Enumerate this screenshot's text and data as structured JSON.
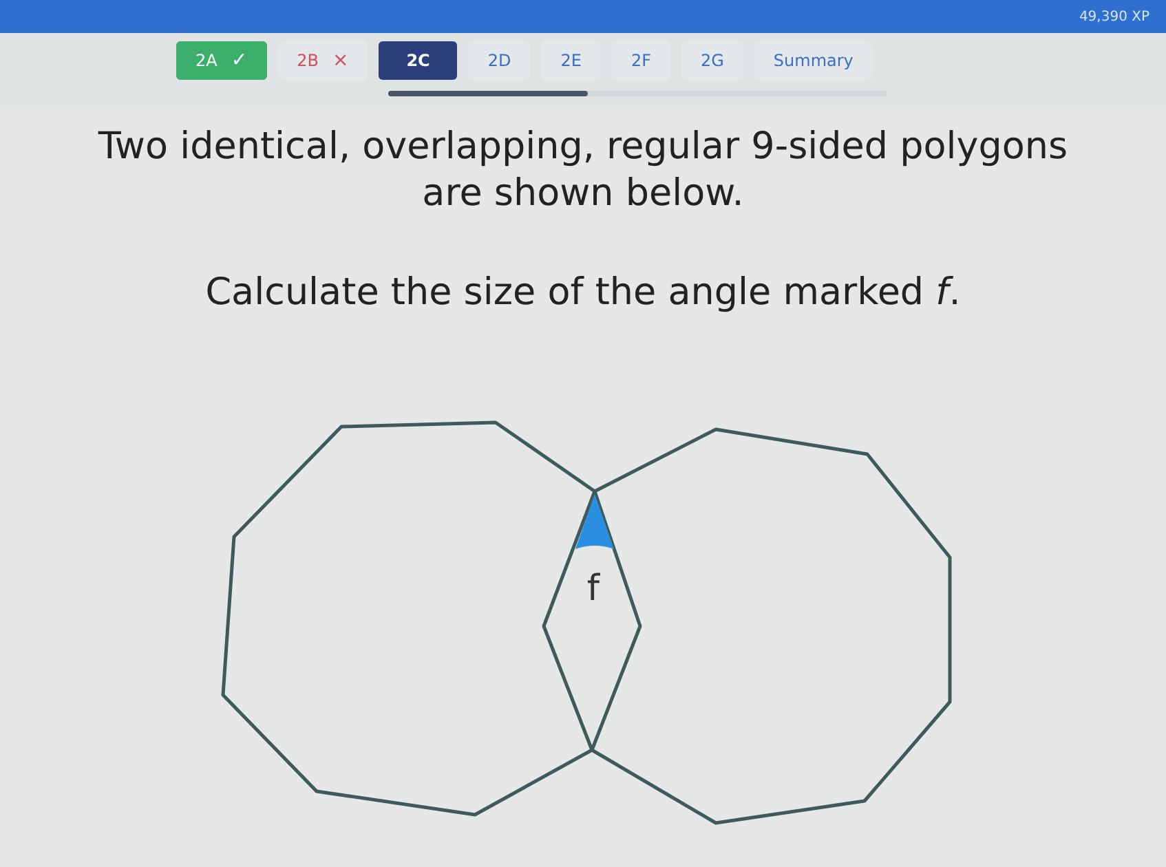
{
  "header": {
    "xp": "49,390 XP"
  },
  "progress": {
    "level": 0.4
  },
  "tabs": [
    {
      "label": "2A",
      "kind": "correct",
      "mark": "✓",
      "selected": false
    },
    {
      "label": "2B",
      "kind": "wrong",
      "mark": "×",
      "selected": false
    },
    {
      "label": "2C",
      "kind": "plain",
      "selected": true
    },
    {
      "label": "2D",
      "kind": "plain",
      "selected": false
    },
    {
      "label": "2E",
      "kind": "plain",
      "selected": false
    },
    {
      "label": "2F",
      "kind": "plain",
      "selected": false
    },
    {
      "label": "2G",
      "kind": "plain",
      "selected": false
    },
    {
      "label": "Summary",
      "kind": "plain",
      "selected": false
    }
  ],
  "question": {
    "lines": [
      "Two identical, overlapping, regular 9-sided polygons are shown below.",
      "Calculate the size of the angle marked *f*."
    ]
  },
  "diagram": {
    "angle_label": "f"
  }
}
